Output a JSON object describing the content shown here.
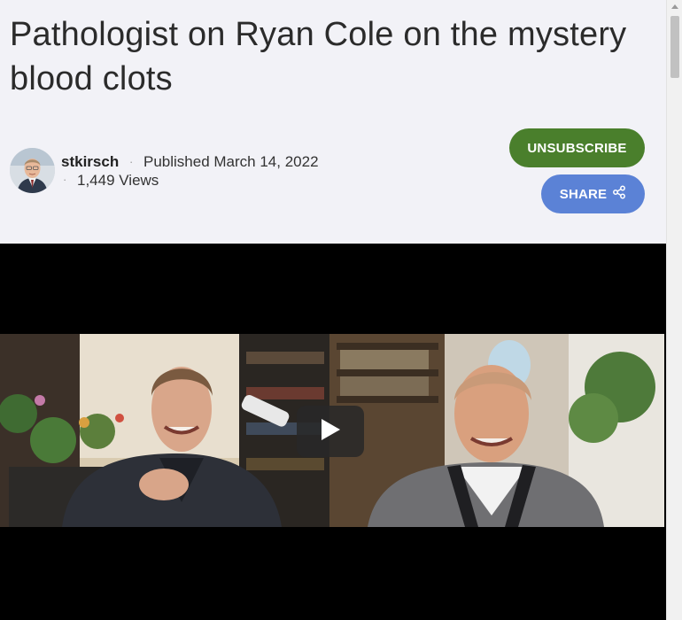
{
  "post": {
    "title": "Pathologist on Ryan Cole on the mystery blood clots",
    "author": "stkirsch",
    "published": "Published March 14, 2022",
    "views": "1,449 Views",
    "separator": "·"
  },
  "actions": {
    "unsubscribe_label": "UNSUBSCRIBE",
    "share_label": "SHARE"
  },
  "video": {
    "play_icon": "play-icon"
  },
  "colors": {
    "unsubscribe": "#4a7f2c",
    "share": "#5b82d6",
    "video_background": "#000000",
    "page_background": "#f2f2f7"
  }
}
